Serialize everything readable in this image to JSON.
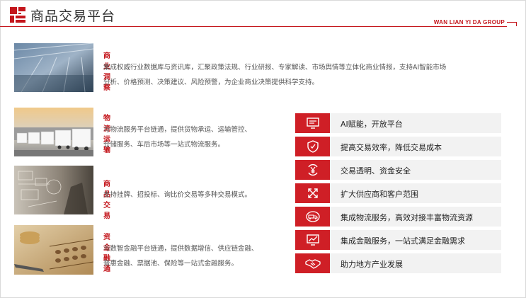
{
  "header": {
    "title": "商品交易平台",
    "brand": "WAN LIAN YI DA GROUP"
  },
  "colors": {
    "accent": "#c4161c",
    "feature_bg": "#f2f2f2"
  },
  "services": [
    {
      "title": "商业洞察",
      "lines": [
        "集成权威行业数据库与资讯库，汇聚政策法规、行业研报、专家解读、市场舆情等立体化商业情报，支持AI智能市场",
        "分析、价格预测、决策建议、风险预警，为企业商业决策提供科学支持。"
      ]
    },
    {
      "title": "物流运输",
      "lines": [
        "与物流服务平台链通，提供货物承运、运输管控、",
        "仓储服务、车后市场等一站式物流服务。"
      ]
    },
    {
      "title": "商品交易",
      "lines": [
        "支持挂牌、招投标、询比价交易等多种交易模式。"
      ]
    },
    {
      "title": "资金融通",
      "lines": [
        "与数智金融平台链通，提供数据增信、供应链金融、",
        "普惠金融、票据池、保险等一站式金融服务。"
      ]
    }
  ],
  "features": [
    {
      "label": "AI赋能，开放平台",
      "icon": "ai-screen-icon"
    },
    {
      "label": "提高交易效率，降低交易成本",
      "icon": "shield-check-icon"
    },
    {
      "label": "交易透明、资金安全",
      "icon": "yuan-cycle-icon"
    },
    {
      "label": "扩大供应商和客户范围",
      "icon": "expand-arrows-icon"
    },
    {
      "label": "集成物流服务，高效对接丰富物流资源",
      "icon": "logistics-icon"
    },
    {
      "label": "集成金融服务，一站式满足金融需求",
      "icon": "finance-chart-icon"
    },
    {
      "label": "助力地方产业发展",
      "icon": "handshake-icon"
    }
  ]
}
